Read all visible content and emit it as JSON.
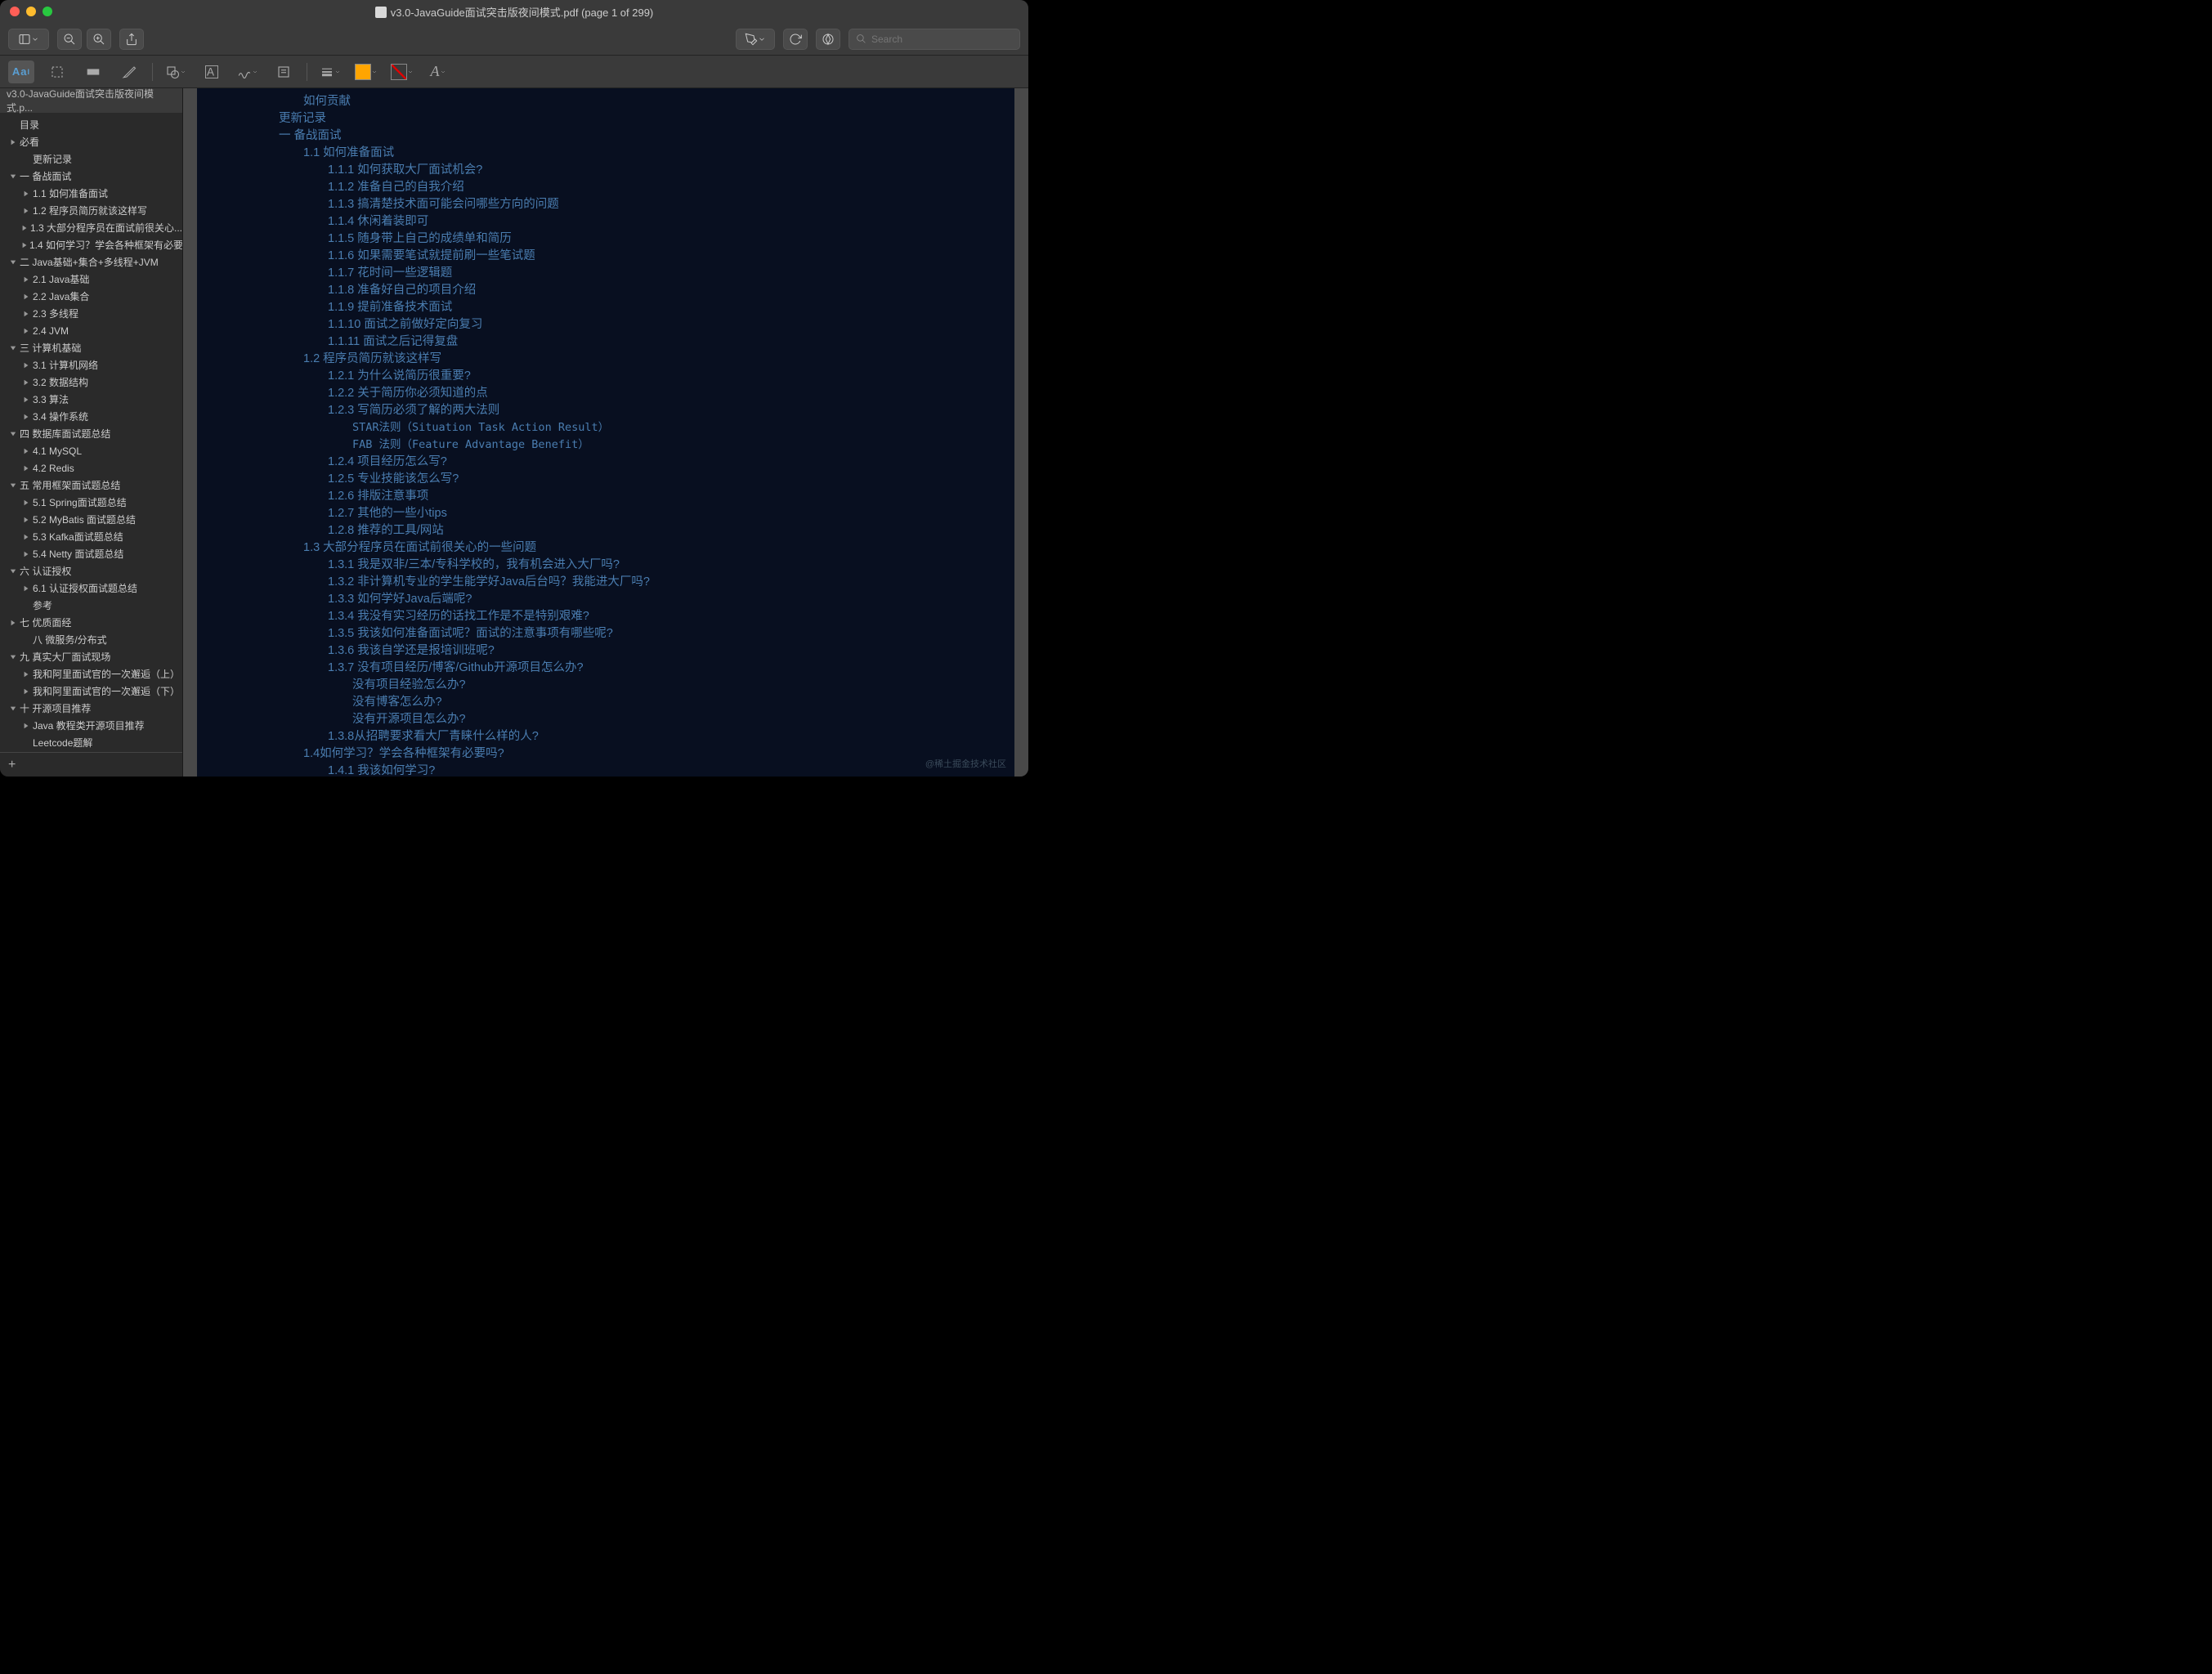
{
  "title": "v3.0-JavaGuide面试突击版夜间模式.pdf (page 1 of 299)",
  "search_placeholder": "Search",
  "sidebar_tab": "v3.0-JavaGuide面试突击版夜间模式.p...",
  "watermark": "@稀土掘金技术社区",
  "outline": [
    {
      "t": "目录",
      "d": 0,
      "a": null
    },
    {
      "t": "必看",
      "d": 0,
      "a": "r"
    },
    {
      "t": "更新记录",
      "d": 1,
      "a": null
    },
    {
      "t": "一 备战面试",
      "d": 0,
      "a": "d"
    },
    {
      "t": "1.1 如何准备面试",
      "d": 1,
      "a": "r"
    },
    {
      "t": "1.2 程序员简历就该这样写",
      "d": 1,
      "a": "r"
    },
    {
      "t": "1.3 大部分程序员在面试前很关心...",
      "d": 1,
      "a": "r"
    },
    {
      "t": "1.4 如何学习？学会各种框架有必要...",
      "d": 1,
      "a": "r"
    },
    {
      "t": "二 Java基础+集合+多线程+JVM",
      "d": 0,
      "a": "d"
    },
    {
      "t": "2.1 Java基础",
      "d": 1,
      "a": "r"
    },
    {
      "t": "2.2 Java集合",
      "d": 1,
      "a": "r"
    },
    {
      "t": "2.3 多线程",
      "d": 1,
      "a": "r"
    },
    {
      "t": "2.4 JVM",
      "d": 1,
      "a": "r"
    },
    {
      "t": "三 计算机基础",
      "d": 0,
      "a": "d"
    },
    {
      "t": "3.1 计算机网络",
      "d": 1,
      "a": "r"
    },
    {
      "t": "3.2 数据结构",
      "d": 1,
      "a": "r"
    },
    {
      "t": "3.3 算法",
      "d": 1,
      "a": "r"
    },
    {
      "t": "3.4 操作系统",
      "d": 1,
      "a": "r"
    },
    {
      "t": "四 数据库面试题总结",
      "d": 0,
      "a": "d"
    },
    {
      "t": "4.1 MySQL",
      "d": 1,
      "a": "r"
    },
    {
      "t": "4.2 Redis",
      "d": 1,
      "a": "r"
    },
    {
      "t": "五 常用框架面试题总结",
      "d": 0,
      "a": "d"
    },
    {
      "t": "5.1 Spring面试题总结",
      "d": 1,
      "a": "r"
    },
    {
      "t": "5.2 MyBatis 面试题总结",
      "d": 1,
      "a": "r"
    },
    {
      "t": "5.3 Kafka面试题总结",
      "d": 1,
      "a": "r"
    },
    {
      "t": "5.4 Netty 面试题总结",
      "d": 1,
      "a": "r"
    },
    {
      "t": "六 认证授权",
      "d": 0,
      "a": "d"
    },
    {
      "t": "6.1 认证授权面试题总结",
      "d": 1,
      "a": "r"
    },
    {
      "t": "参考",
      "d": 1,
      "a": null
    },
    {
      "t": "七 优质面经",
      "d": 0,
      "a": "r"
    },
    {
      "t": "八 微服务/分布式",
      "d": 1,
      "a": null
    },
    {
      "t": "九 真实大厂面试现场",
      "d": 0,
      "a": "d"
    },
    {
      "t": "我和阿里面试官的一次邂逅（上）",
      "d": 1,
      "a": "r"
    },
    {
      "t": "我和阿里面试官的一次邂逅（下）",
      "d": 1,
      "a": "r"
    },
    {
      "t": "十 开源项目推荐",
      "d": 0,
      "a": "d"
    },
    {
      "t": "Java 教程类开源项目推荐",
      "d": 1,
      "a": "r"
    },
    {
      "t": "Leetcode题解",
      "d": 1,
      "a": null
    }
  ],
  "toc": [
    {
      "i": 3,
      "t": "如何贡献"
    },
    {
      "i": 2,
      "t": "更新记录"
    },
    {
      "i": 2,
      "t": "一 备战面试"
    },
    {
      "i": 3,
      "t": "1.1 如何准备面试"
    },
    {
      "i": 4,
      "t": "1.1.1 如何获取大厂面试机会?"
    },
    {
      "i": 4,
      "t": "1.1.2 准备自己的自我介绍"
    },
    {
      "i": 4,
      "t": "1.1.3 搞清楚技术面可能会问哪些方向的问题"
    },
    {
      "i": 4,
      "t": "1.1.4 休闲着装即可"
    },
    {
      "i": 4,
      "t": "1.1.5 随身带上自己的成绩单和简历"
    },
    {
      "i": 4,
      "t": "1.1.6 如果需要笔试就提前刷一些笔试题"
    },
    {
      "i": 4,
      "t": "1.1.7 花时间一些逻辑题"
    },
    {
      "i": 4,
      "t": "1.1.8 准备好自己的项目介绍"
    },
    {
      "i": 4,
      "t": "1.1.9 提前准备技术面试"
    },
    {
      "i": 4,
      "t": "1.1.10 面试之前做好定向复习"
    },
    {
      "i": 4,
      "t": "1.1.11 面试之后记得复盘"
    },
    {
      "i": 3,
      "t": "1.2 程序员简历就该这样写"
    },
    {
      "i": 4,
      "t": "1.2.1 为什么说简历很重要?"
    },
    {
      "i": 4,
      "t": "1.2.2 关于简历你必须知道的点"
    },
    {
      "i": 4,
      "t": "1.2.3 写简历必须了解的两大法则"
    },
    {
      "i": 5,
      "t": "STAR法则（Situation Task Action Result）",
      "m": true
    },
    {
      "i": 5,
      "t": "FAB 法则（Feature Advantage Benefit）",
      "m": true
    },
    {
      "i": 4,
      "t": "1.2.4 项目经历怎么写?"
    },
    {
      "i": 4,
      "t": "1.2.5 专业技能该怎么写?"
    },
    {
      "i": 4,
      "t": "1.2.6 排版注意事项"
    },
    {
      "i": 4,
      "t": "1.2.7 其他的一些小tips"
    },
    {
      "i": 4,
      "t": "1.2.8 推荐的工具/网站"
    },
    {
      "i": 3,
      "t": "1.3 大部分程序员在面试前很关心的一些问题"
    },
    {
      "i": 4,
      "t": "1.3.1 我是双非/三本/专科学校的，我有机会进入大厂吗?"
    },
    {
      "i": 4,
      "t": "1.3.2 非计算机专业的学生能学好Java后台吗？我能进大厂吗?"
    },
    {
      "i": 4,
      "t": "1.3.3 如何学好Java后端呢?"
    },
    {
      "i": 4,
      "t": "1.3.4 我没有实习经历的话找工作是不是特别艰难?"
    },
    {
      "i": 4,
      "t": "1.3.5 我该如何准备面试呢？面试的注意事项有哪些呢?"
    },
    {
      "i": 4,
      "t": "1.3.6 我该自学还是报培训班呢?"
    },
    {
      "i": 4,
      "t": "1.3.7 没有项目经历/博客/Github开源项目怎么办?"
    },
    {
      "i": 5,
      "t": "没有项目经验怎么办?"
    },
    {
      "i": 5,
      "t": "没有博客怎么办?"
    },
    {
      "i": 5,
      "t": "没有开源项目怎么办?"
    },
    {
      "i": 4,
      "t": "1.3.8从招聘要求看大厂青睐什么样的人?"
    },
    {
      "i": 3,
      "t": "1.4如何学习？学会各种框架有必要吗?"
    },
    {
      "i": 4,
      "t": "1.4.1 我该如何学习?"
    }
  ]
}
